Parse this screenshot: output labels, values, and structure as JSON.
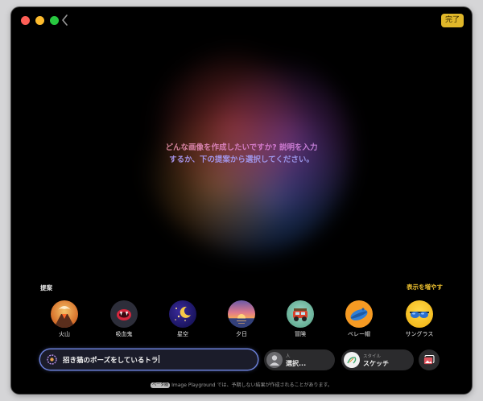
{
  "window": {
    "done_label": "完了"
  },
  "prompt": {
    "line1": "どんな画像を作成したいですか? 説明を入力",
    "line2": "するか、下の提案から選択してください。"
  },
  "suggestions": {
    "label": "提案",
    "more_label": "表示を増やす",
    "items": [
      {
        "label": "火山",
        "icon": "volcano-icon"
      },
      {
        "label": "吸血鬼",
        "icon": "vampire-icon"
      },
      {
        "label": "星空",
        "icon": "starry-sky-icon"
      },
      {
        "label": "夕日",
        "icon": "sunset-icon"
      },
      {
        "label": "冒険",
        "icon": "adventure-vehicle-icon"
      },
      {
        "label": "ベレー帽",
        "icon": "beret-icon"
      },
      {
        "label": "サングラス",
        "icon": "sunglasses-icon"
      }
    ]
  },
  "input": {
    "value": "招き猫のポーズをしているトラ"
  },
  "person": {
    "small": "人",
    "value": "選択..."
  },
  "style": {
    "small": "スタイル",
    "value": "スケッチ"
  },
  "footer": {
    "badge": "ベータ版",
    "text": "Image Playground では、予期しない結果が作成されることがあります。"
  },
  "colors": {
    "accent": "#f0c330",
    "done_bg": "#e0b72a",
    "input_glow": "#6a7fd6"
  }
}
